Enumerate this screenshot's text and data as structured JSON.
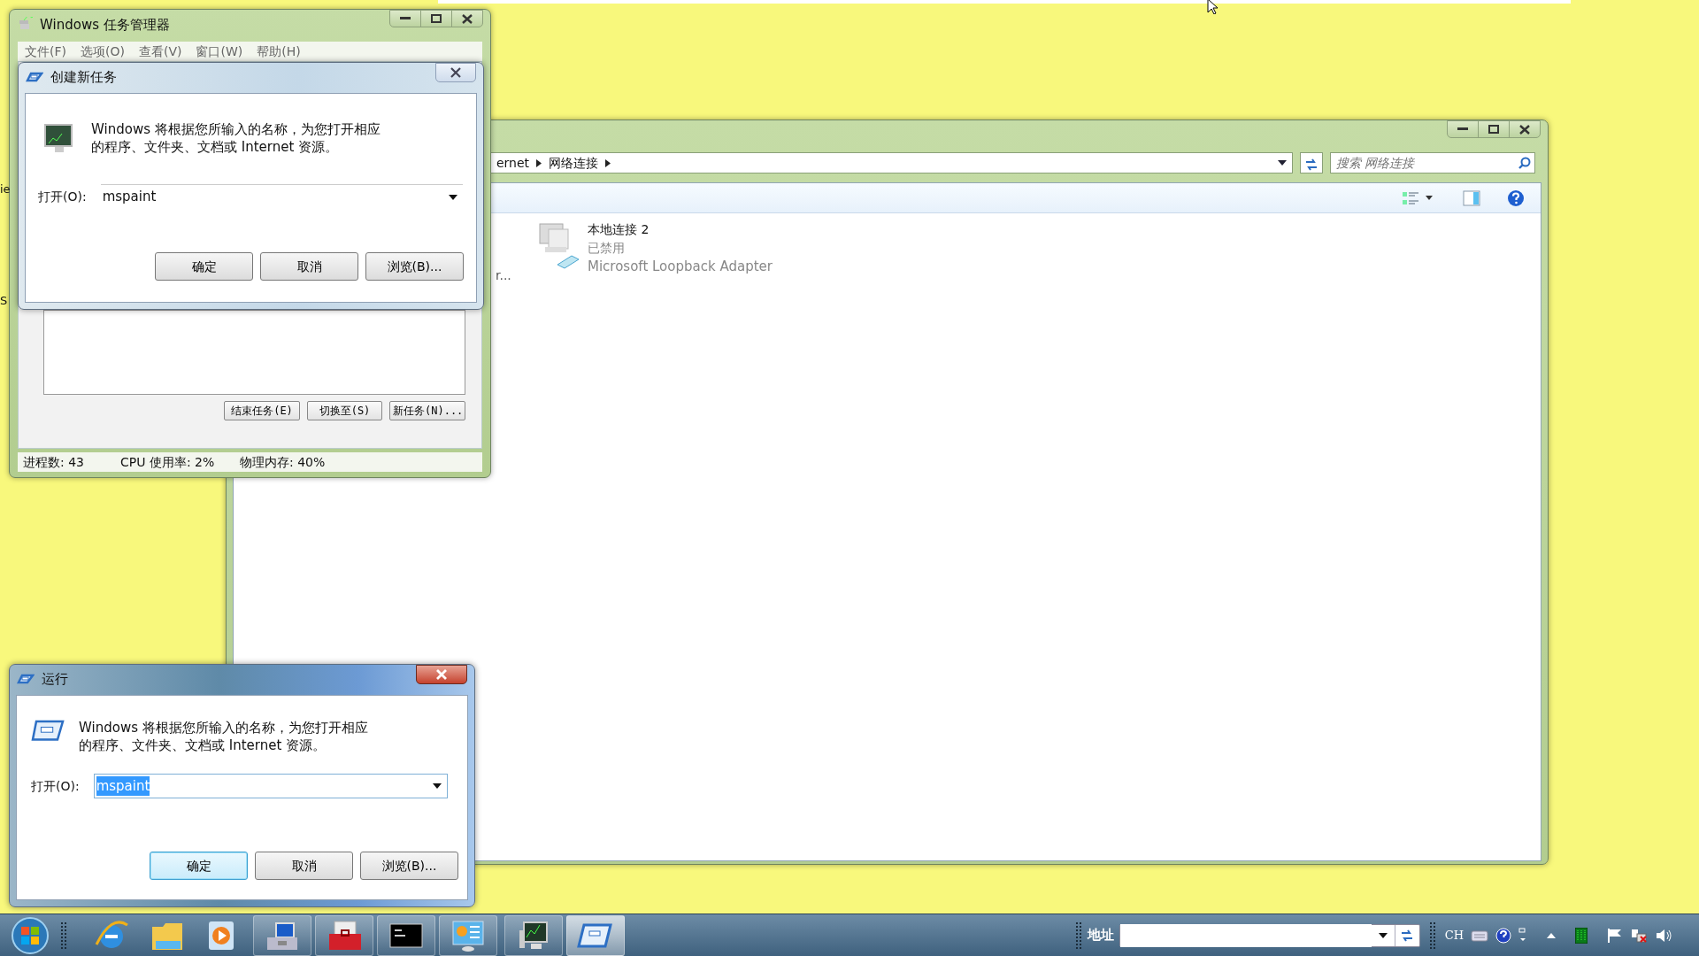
{
  "desktop": {
    "edge_fragments": [
      "ie",
      "S"
    ]
  },
  "task_manager": {
    "title": "Windows 任务管理器",
    "menu": [
      "文件(F)",
      "选项(O)",
      "查看(V)",
      "窗口(W)",
      "帮助(H)"
    ],
    "buttons": [
      "结束任务(E)",
      "切换至(S)",
      "新任务(N)..."
    ],
    "status": [
      "进程数: 43",
      "CPU 使用率: 2%",
      "物理内存: 40%"
    ]
  },
  "create_task": {
    "title": "创建新任务",
    "message": "Windows 将根据您所输入的名称，为您打开相应的程序、文件夹、文档或 Internet 资源。",
    "open_label": "打开(O):",
    "value": "mspaint",
    "buttons": [
      "确定",
      "取消",
      "浏览(B)..."
    ]
  },
  "explorer": {
    "breadcrumb": [
      "ernet",
      "网络连接"
    ],
    "search_placeholder": "搜索 网络连接",
    "left_fragment": "r...",
    "items": [
      {
        "name": "本地连接 2",
        "status": "已禁用",
        "device": "Microsoft Loopback Adapter"
      }
    ]
  },
  "run": {
    "title": "运行",
    "message": "Windows 将根据您所输入的名称，为您打开相应的程序、文件夹、文档或 Internet 资源。",
    "open_label": "打开(O):",
    "value": "mspaint",
    "value_selected": true,
    "buttons": [
      {
        "label": "确定",
        "default": true
      },
      {
        "label": "取消",
        "default": false
      },
      {
        "label": "浏览(B)...",
        "default": false
      }
    ]
  },
  "taskbar": {
    "windows": [
      {
        "selected": false
      },
      {
        "selected": false
      },
      {
        "selected": false
      },
      {
        "selected": false
      },
      {
        "selected": false
      },
      {
        "selected": true
      }
    ],
    "address_label": "地址",
    "language": "CH"
  }
}
